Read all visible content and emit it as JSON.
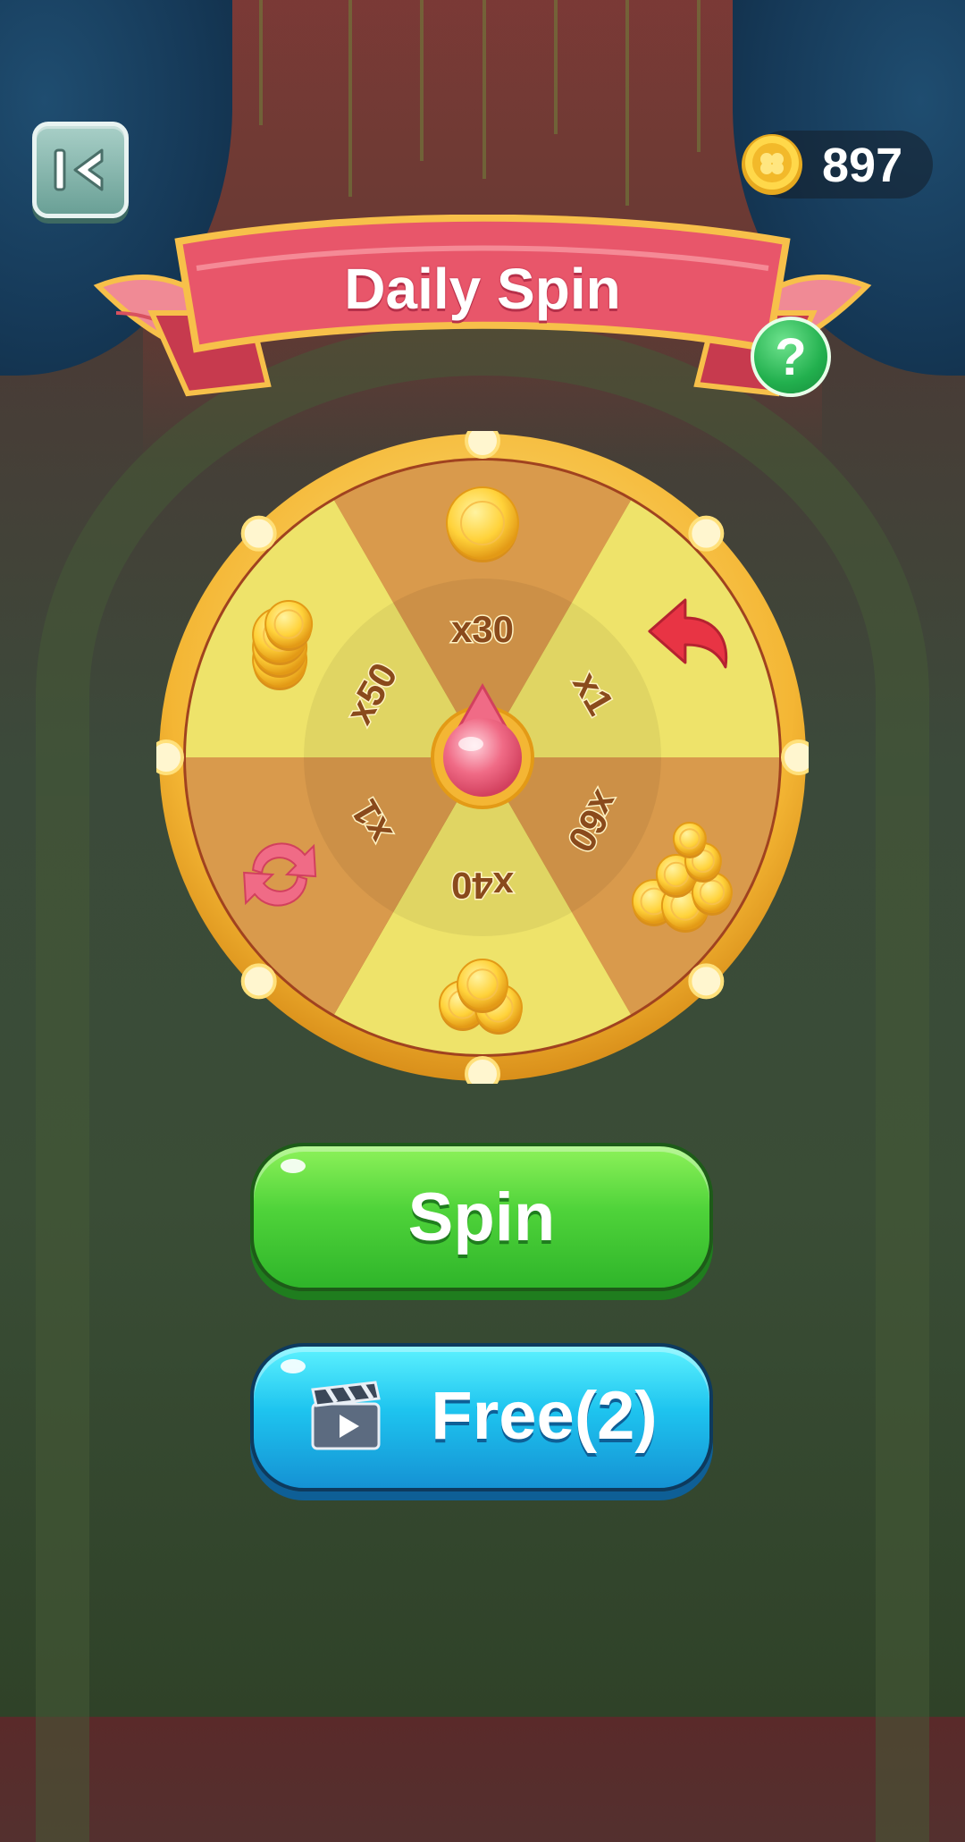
{
  "header": {
    "back_icon": "back-to-start-icon",
    "coin_icon": "clover-coin-icon",
    "coin_count": "897"
  },
  "banner": {
    "title": "Daily Spin",
    "help_label": "?"
  },
  "wheel": {
    "segments": [
      {
        "multiplier": "x30",
        "icon": "single-coin-icon",
        "color": "#d99a4c"
      },
      {
        "multiplier": "x1",
        "icon": "red-back-arrow-icon",
        "color": "#eee36a"
      },
      {
        "multiplier": "x60",
        "icon": "coin-pile-icon",
        "color": "#d99a4c"
      },
      {
        "multiplier": "x40",
        "icon": "coin-stack-icon",
        "color": "#eee36a"
      },
      {
        "multiplier": "x1",
        "icon": "refresh-arrows-icon",
        "color": "#d99a4c"
      },
      {
        "multiplier": "x50",
        "icon": "gold-coin-stack-icon",
        "color": "#eee36a"
      }
    ],
    "pointer_icon": "pink-pointer-icon"
  },
  "buttons": {
    "spin_label": "Spin",
    "free_label": "Free(2)",
    "free_icon": "clapperboard-video-icon"
  },
  "colors": {
    "spin_green": "#3fc530",
    "free_blue": "#1ec4ef",
    "banner_red": "#e8566a",
    "gold": "#f4c23a"
  }
}
